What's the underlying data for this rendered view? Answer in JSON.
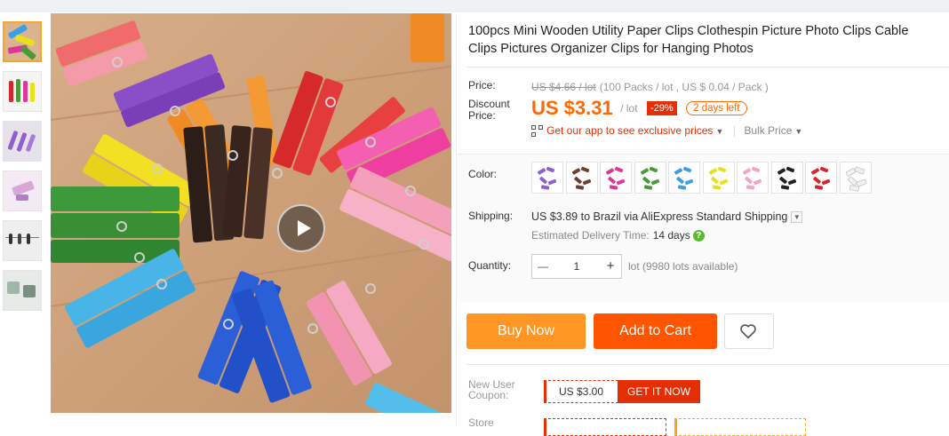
{
  "product": {
    "title": "100pcs Mini Wooden Utility Paper Clips Clothespin Picture Photo Clips Cable Clips Pictures Organizer Clips for Hanging Photos"
  },
  "gallery": {
    "thumbnail_count": 6,
    "active_thumbnail": 1,
    "video_play_icon": "play-icon"
  },
  "price": {
    "label": "Price:",
    "original": "US $4.66 / lot",
    "pack_info": "(100 Packs / lot , US $ 0.04 / Pack )",
    "discount_label_line1": "Discount",
    "discount_label_line2": "Price:",
    "sale": "US $3.31",
    "unit": "/ lot",
    "discount_badge": "-29%",
    "days_left": "2 days left",
    "app_link": "Get our app to see exclusive prices",
    "bulk_price": "Bulk Price"
  },
  "color": {
    "label": "Color:",
    "options": [
      "purple",
      "brown",
      "pink-magenta",
      "green",
      "light-blue",
      "yellow",
      "light-pink",
      "black",
      "red",
      "white"
    ],
    "swatch_colors": [
      "#8e5fd0",
      "#6b4030",
      "#e0369a",
      "#4a9a3a",
      "#3b9fe6",
      "#e8e01c",
      "#f4a5c0",
      "#222222",
      "#d9252a",
      "#f2f2f2"
    ]
  },
  "shipping": {
    "label": "Shipping:",
    "text": "US $3.89 to Brazil via AliExpress Standard Shipping",
    "delivery_label": "Estimated Delivery Time:",
    "delivery_days": "14 days",
    "help_icon": "?"
  },
  "quantity": {
    "label": "Quantity:",
    "minus": "—",
    "value": "1",
    "plus": "+",
    "availability": "lot (9980 lots available)"
  },
  "actions": {
    "buy_now": "Buy Now",
    "add_to_cart": "Add to Cart",
    "wishlist_icon": "heart-icon"
  },
  "coupon": {
    "label_line1": "New User",
    "label_line2": "Coupon:",
    "value": "US $3.00",
    "button": "GET IT NOW"
  },
  "store": {
    "label": "Store"
  },
  "colors": {
    "accent_orange": "#ff5500",
    "buy_orange": "#ff9624",
    "price_orange": "#ff6600",
    "discount_red": "#e62e04"
  }
}
